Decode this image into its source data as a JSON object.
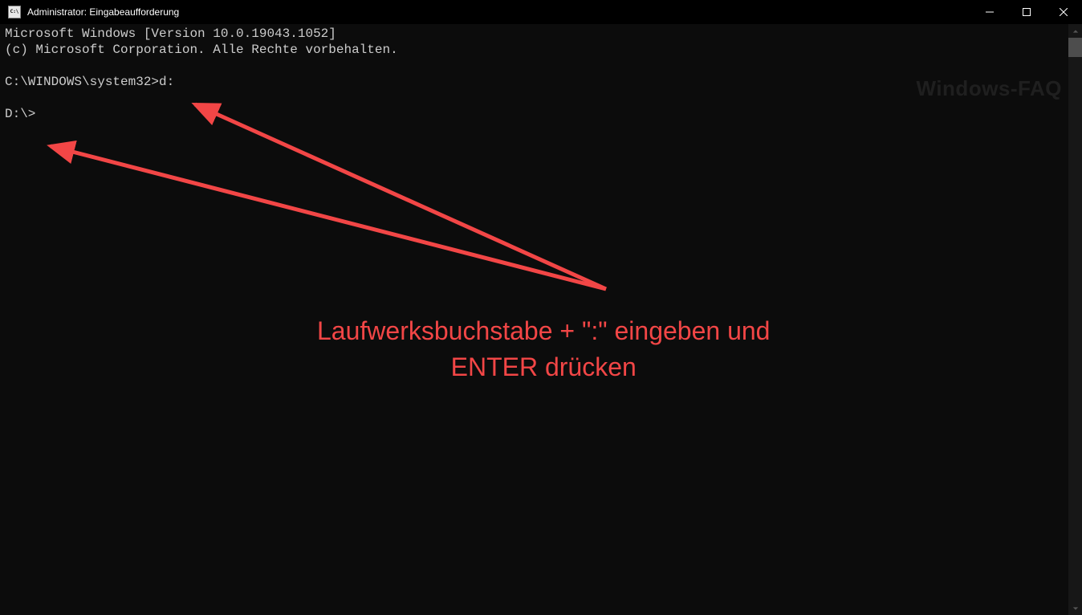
{
  "window": {
    "title": "Administrator: Eingabeaufforderung"
  },
  "console": {
    "line1": "Microsoft Windows [Version 10.0.19043.1052]",
    "line2": "(c) Microsoft Corporation. Alle Rechte vorbehalten.",
    "blank1": "",
    "line3": "C:\\WINDOWS\\system32>d:",
    "blank2": "",
    "line4": "D:\\>"
  },
  "annotation": {
    "text": "Laufwerksbuchstabe + \":\" eingeben und\nENTER drücken"
  },
  "watermark": {
    "text": "Windows-FAQ"
  },
  "colors": {
    "annotation": "#f24646",
    "console_bg": "#0c0c0c",
    "console_fg": "#cccccc"
  }
}
